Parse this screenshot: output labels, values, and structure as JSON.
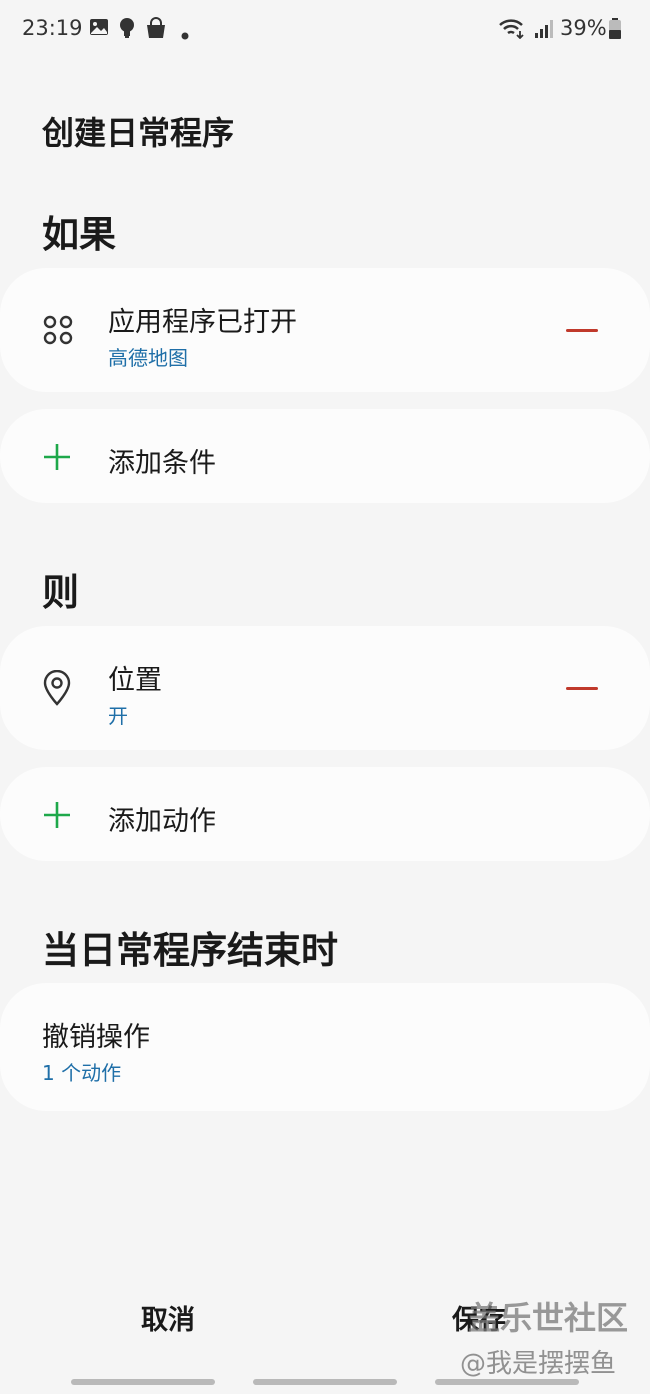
{
  "status_bar": {
    "time": "23:19",
    "battery": "39%",
    "icons": [
      "image-icon",
      "bulb-icon",
      "shopping-bag-icon",
      "dot-icon",
      "wifi-icon",
      "signal-icon",
      "battery-icon"
    ]
  },
  "page_title": "创建日常程序",
  "if_section": {
    "heading": "如果",
    "condition": {
      "title": "应用程序已打开",
      "subtitle": "高德地图",
      "icon": "apps-icon"
    },
    "add_label": "添加条件"
  },
  "then_section": {
    "heading": "则",
    "action": {
      "title": "位置",
      "subtitle": "开",
      "icon": "location-pin-icon"
    },
    "add_label": "添加动作"
  },
  "end_section": {
    "heading": "当日常程序结束时",
    "undo": {
      "title": "撤销操作",
      "subtitle": "1 个动作"
    }
  },
  "bottom_bar": {
    "cancel_label": "取消",
    "save_label": "保存"
  },
  "watermark": {
    "line1": "盖乐世社区",
    "line2": "@我是摆摆鱼"
  },
  "colors": {
    "accent_blue": "#1f6fa8",
    "add_green": "#1ea84a",
    "remove_red": "#c0392b",
    "background": "#f5f5f5",
    "card": "#fcfcfc"
  }
}
